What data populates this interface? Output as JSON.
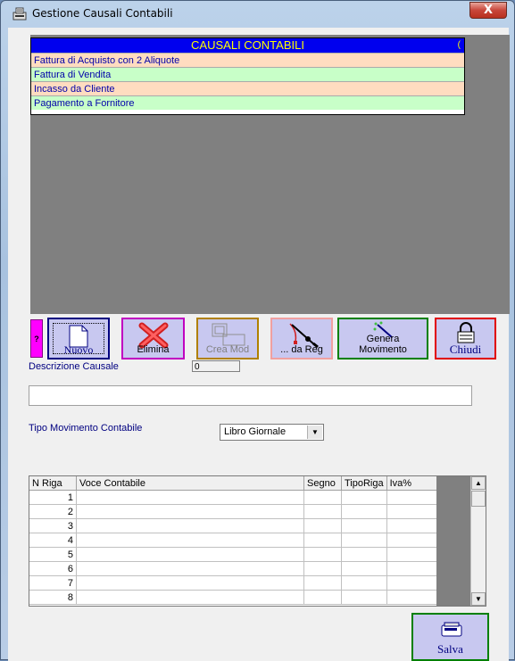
{
  "window": {
    "title": "Gestione Causali Contabili",
    "close_label": "X"
  },
  "causali_list": {
    "header": "CAUSALI CONTABILI",
    "header_mark": "(",
    "items": [
      {
        "label": "Fattura di Acquisto con 2 Aliquote"
      },
      {
        "label": "Fattura di Vendita"
      },
      {
        "label": "Incasso da Cliente"
      },
      {
        "label": "Pagamento a Fornitore"
      }
    ]
  },
  "toolbar": {
    "help_label": "?",
    "nuovo_label": "Nuovo",
    "elimina_label": "Elimina",
    "creamod_label": "Crea Mod",
    "dareg_label": "... da Reg",
    "genera_label_1": "Genera",
    "genera_label_2": "Movimento",
    "chiudi_label": "Chiudi"
  },
  "form": {
    "descrizione_label": "Descrizione Causale",
    "id_value": "0",
    "descrizione_value": "",
    "tipo_label": "Tipo Movimento Contabile",
    "tipo_value": "Libro Giornale"
  },
  "grid": {
    "columns": [
      "N Riga",
      "Voce Contabile",
      "Segno",
      "TipoRiga",
      "Iva%"
    ],
    "rows": [
      "1",
      "2",
      "3",
      "4",
      "5",
      "6",
      "7",
      "8"
    ]
  },
  "salva_label": "Salva",
  "colors": {
    "list_header_bg": "#0000ee",
    "list_header_text": "#ffff00",
    "row_orange": "#ffdcc0",
    "row_green": "#c8ffc8",
    "accent_green": "#008000",
    "accent_red": "#e00000"
  }
}
